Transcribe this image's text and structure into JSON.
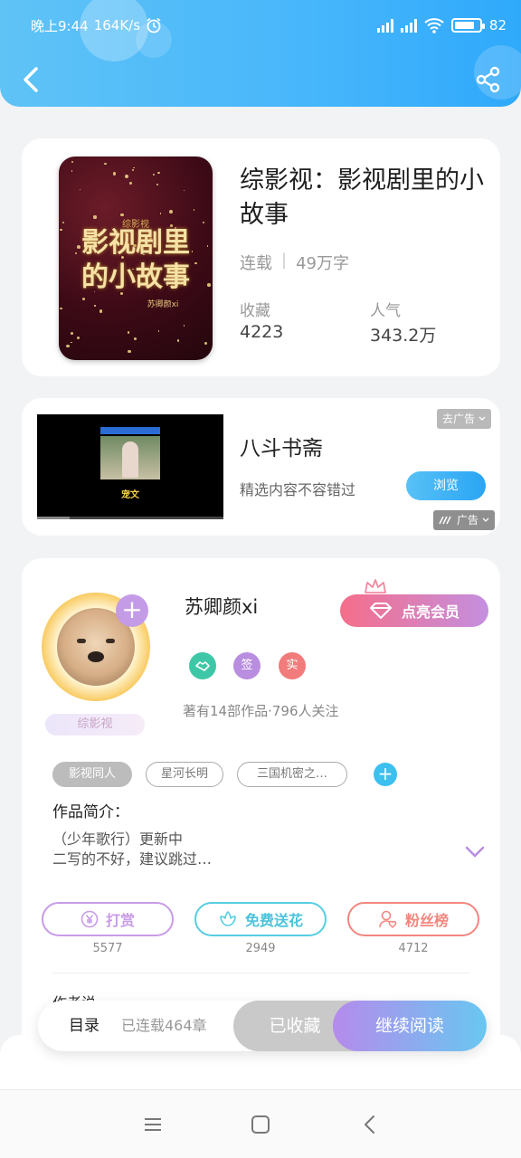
{
  "status_bar": {
    "time": "晚上9:44",
    "speed": "164K/s",
    "battery": "82",
    "battery_level": 0.82
  },
  "header": {
    "back_icon": "chevron-left-icon",
    "share_icon": "share-icon"
  },
  "book": {
    "cover_title_line1": "影视剧里",
    "cover_title_line2": "的小故事",
    "cover_label": "综影视",
    "cover_author": "苏卿颜xi",
    "title": "综影视：影视剧里的小故事",
    "status": "连载",
    "separator": "|",
    "word_count": "49万字",
    "collect_label": "收藏",
    "collect_value": "4223",
    "popularity_label": "人气",
    "popularity_value": "343.2万"
  },
  "ad": {
    "title": "八斗书斋",
    "description": "精选内容不容错过",
    "button": "浏览",
    "dismiss_label": "去广告",
    "ad_label": "广告",
    "video_caption": "宠文"
  },
  "author": {
    "name": "苏卿颜xi",
    "vip_button": "点亮会员",
    "badge": "综影视",
    "medals": [
      {
        "label": "",
        "color": "#3ec7a6",
        "icon": "handshake-icon"
      },
      {
        "label": "签",
        "color": "#b98ee0"
      },
      {
        "label": "实",
        "color": "#f27b7b"
      }
    ],
    "meta": "著有14部作品·796人关注",
    "tags": [
      "影视同人",
      "星河长明",
      "三国机密之…"
    ],
    "intro_title": "作品简介：",
    "intro_line1": "（少年歌行）更新中",
    "intro_line2": "二写的不好，建议跳过…",
    "actions": [
      {
        "label": "打赏",
        "count": "5577",
        "color": "#c89be8",
        "icon": "yen-icon"
      },
      {
        "label": "免费送花",
        "count": "2949",
        "color": "#56cde3",
        "icon": "flower-icon"
      },
      {
        "label": "粉丝榜",
        "count": "4712",
        "color": "#f2877f",
        "icon": "fan-icon"
      }
    ],
    "says_label": "作者说"
  },
  "bottom_bar": {
    "catalog": "目录",
    "serial_status": "已连载464章",
    "collected": "已收藏",
    "continue_reading": "继续阅读"
  },
  "colors": {
    "header_gradient_start": "#5fc3f6",
    "header_gradient_end": "#2fa9fb",
    "vip_gradient_start": "#f56e8a",
    "vip_gradient_end": "#c48fe0",
    "read_gradient_start": "#b58bec",
    "read_gradient_end": "#68c7f1"
  }
}
